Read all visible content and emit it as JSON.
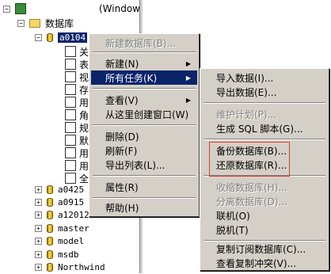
{
  "tree": {
    "top_row_label": "(Window",
    "root_label": "数据库",
    "selected_db": "a0104",
    "child_nodes": [
      {
        "label": "关",
        "icon": "diagram-icon"
      },
      {
        "label": "表",
        "icon": "table-icon"
      },
      {
        "label": "视",
        "icon": "view-icon"
      },
      {
        "label": "存",
        "icon": "stored-procedure-icon"
      },
      {
        "label": "用",
        "icon": "user-icon"
      },
      {
        "label": "角",
        "icon": "role-icon"
      },
      {
        "label": "规",
        "icon": "rule-icon"
      },
      {
        "label": "默",
        "icon": "default-icon"
      },
      {
        "label": "用",
        "icon": "user-type-icon"
      },
      {
        "label": "用",
        "icon": "user-function-icon"
      },
      {
        "label": "全",
        "icon": "fulltext-icon"
      }
    ],
    "other_dbs": [
      "a0425",
      "a0915",
      "a12012",
      "master",
      "model",
      "msdb",
      "Northwind"
    ]
  },
  "context_menu": {
    "items": [
      {
        "label": "新建数据库(B)...",
        "disabled": true
      },
      {
        "label": "新建(N)",
        "submenu": true
      },
      {
        "label": "所有任务(K)",
        "submenu": true,
        "active": true
      },
      {
        "label": "查看(V)",
        "submenu": true
      },
      {
        "label": "从这里创建窗口(W)"
      },
      {
        "label": "删除(D)"
      },
      {
        "label": "刷新(F)"
      },
      {
        "label": "导出列表(L)..."
      },
      {
        "label": "属性(R)"
      },
      {
        "label": "帮助(H)"
      }
    ]
  },
  "submenu": {
    "items": [
      {
        "label": "导入数据(I)..."
      },
      {
        "label": "导出数据(E)..."
      },
      {
        "label": "维护计划(P)...",
        "disabled": true
      },
      {
        "label": "生成 SQL 脚本(G)..."
      },
      {
        "label": "备份数据库(B)..."
      },
      {
        "label": "还原数据库(R)..."
      },
      {
        "label": "收缩数据库(H)...",
        "disabled": true
      },
      {
        "label": "分离数据库(D)...",
        "disabled": true
      },
      {
        "label": "联机(O)"
      },
      {
        "label": "脱机(T)"
      },
      {
        "label": "复制订阅数据库(C)..."
      },
      {
        "label": "查看复制冲突(V)..."
      }
    ]
  },
  "colors": {
    "selection": "#0a246a",
    "menu_bg": "#d4d0c8",
    "annotation_box": "#e23a2a"
  }
}
